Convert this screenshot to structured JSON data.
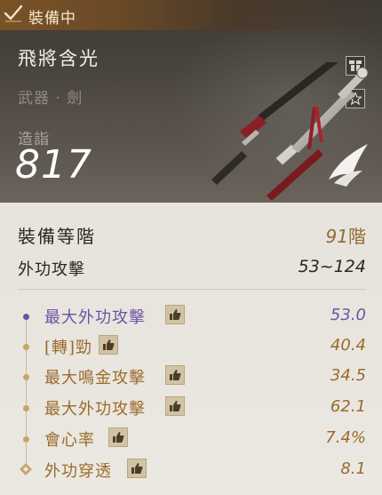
{
  "header": {
    "equip_status": "裝備中",
    "item_name": "飛將含光",
    "item_type": "武器 · 劍",
    "cost_label": "造詣",
    "cost_value": "817"
  },
  "body": {
    "grade_label": "裝備等階",
    "grade_number": "91",
    "grade_unit": "階",
    "attack_label": "外功攻擊",
    "attack_value": "53~124",
    "stats": [
      {
        "name": "最大外功攻擊",
        "value": "53.0",
        "color": "purple"
      },
      {
        "name": "[轉]勁",
        "value": "40.4",
        "color": "gold"
      },
      {
        "name": "最大鳴金攻擊",
        "value": "34.5",
        "color": "gold"
      },
      {
        "name": "最大外功攻擊",
        "value": "62.1",
        "color": "gold"
      },
      {
        "name": "會心率",
        "value": "7.4%",
        "color": "gold"
      },
      {
        "name": "外功穿透",
        "value": "8.1",
        "color": "gold"
      }
    ]
  },
  "colors": {
    "purple": "#6e52a6",
    "gold": "#9a6b2a",
    "equip_bar": "#7a5227"
  },
  "icons": {
    "equip": "checkmark-icon",
    "gift": "gift-icon",
    "favorite": "star-icon",
    "recommend": "thumbs-up-icon",
    "final_stat": "diamond-marker-icon",
    "quality_emblem": "wing-icon"
  }
}
